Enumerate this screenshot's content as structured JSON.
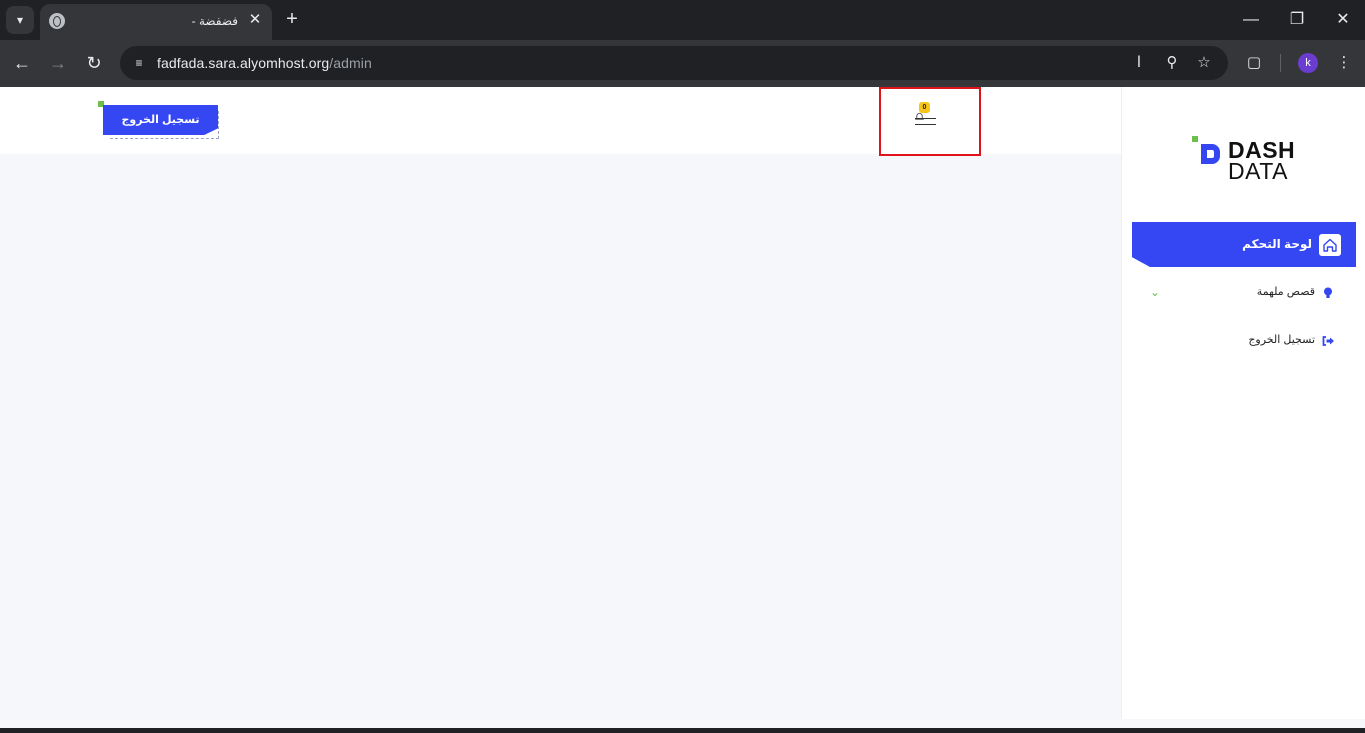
{
  "browser": {
    "tab_title": "فضفضة -",
    "url_host": "fadfada.sara.alyomhost.org",
    "url_path": "/admin",
    "profile_initial": "k",
    "icons": {
      "tab_search": "chevron-down-icon",
      "favicon": "globe-icon",
      "tab_close": "close-icon",
      "new_tab": "plus-icon",
      "minimize": "minimize-icon",
      "restore": "restore-icon",
      "close_window": "close-icon",
      "back": "arrow-left-icon",
      "forward": "arrow-right-icon",
      "reload": "reload-icon",
      "site_info": "tune-icon",
      "translate": "translate-icon",
      "zoom": "zoom-icon",
      "bookmark": "star-icon",
      "extensions": "puzzle-icon",
      "menu": "kebab-menu-icon"
    }
  },
  "header": {
    "logout_label": "تسجيل الخروج",
    "notification_count": "0"
  },
  "sidebar": {
    "logo_line1": "DASH",
    "logo_line2": "DATA",
    "items": [
      {
        "label": "لوحة التحكم",
        "icon": "home-icon",
        "active": true
      },
      {
        "label": "قصص ملهمة",
        "icon": "lightbulb-icon",
        "active": false,
        "expandable": true
      },
      {
        "label": "تسجيل الخروج",
        "icon": "logout-icon",
        "active": false
      }
    ]
  },
  "colors": {
    "accent": "#3547f2",
    "green": "#6cc04a",
    "badge": "#f5c518",
    "highlight": "#e0131a",
    "page_bg": "#f6f7fb"
  }
}
